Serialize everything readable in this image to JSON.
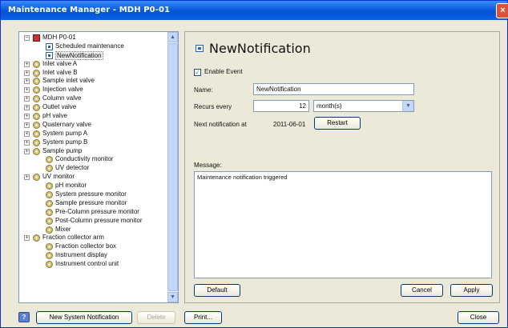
{
  "window": {
    "title": "Maintenance Manager - MDH P0-01",
    "close_glyph": "×"
  },
  "tree": {
    "items": [
      {
        "label": "MDH P0-01",
        "icon": "root-icon",
        "level": 0,
        "expander": "−"
      },
      {
        "label": "Scheduled maintenance",
        "icon": "notification-icon",
        "level": 1,
        "expander": ""
      },
      {
        "label": "NewNotification",
        "icon": "notification-icon",
        "level": 1,
        "expander": "",
        "selected": true
      },
      {
        "label": "Inlet valve A",
        "icon": "gear-icon",
        "level": 0,
        "expander": "+"
      },
      {
        "label": "Inlet valve B",
        "icon": "gear-icon",
        "level": 0,
        "expander": "+"
      },
      {
        "label": "Sample inlet valve",
        "icon": "gear-icon",
        "level": 0,
        "expander": "+"
      },
      {
        "label": "Injection valve",
        "icon": "gear-icon",
        "level": 0,
        "expander": "+"
      },
      {
        "label": "Column valve",
        "icon": "gear-icon",
        "level": 0,
        "expander": "+"
      },
      {
        "label": "Outlet valve",
        "icon": "gear-icon",
        "level": 0,
        "expander": "+"
      },
      {
        "label": "pH valve",
        "icon": "gear-icon",
        "level": 0,
        "expander": "+"
      },
      {
        "label": "Quaternary valve",
        "icon": "gear-icon",
        "level": 0,
        "expander": "+"
      },
      {
        "label": "System pump A",
        "icon": "gear-icon",
        "level": 0,
        "expander": "+"
      },
      {
        "label": "System pump B",
        "icon": "gear-icon",
        "level": 0,
        "expander": "+"
      },
      {
        "label": "Sample pump",
        "icon": "gear-icon",
        "level": 0,
        "expander": "+"
      },
      {
        "label": "Conductivity monitor",
        "icon": "gear-icon",
        "level": 1,
        "expander": ""
      },
      {
        "label": "UV detector",
        "icon": "gear-icon",
        "level": 1,
        "expander": ""
      },
      {
        "label": "UV monitor",
        "icon": "gear-icon",
        "level": 0,
        "expander": "+"
      },
      {
        "label": "pH monitor",
        "icon": "gear-icon",
        "level": 1,
        "expander": ""
      },
      {
        "label": "System pressure monitor",
        "icon": "gear-icon",
        "level": 1,
        "expander": ""
      },
      {
        "label": "Sample pressure monitor",
        "icon": "gear-icon",
        "level": 1,
        "expander": ""
      },
      {
        "label": "Pre-Column pressure monitor",
        "icon": "gear-icon",
        "level": 1,
        "expander": ""
      },
      {
        "label": "Post-Column pressure monitor",
        "icon": "gear-icon",
        "level": 1,
        "expander": ""
      },
      {
        "label": "Mixer",
        "icon": "gear-icon",
        "level": 1,
        "expander": ""
      },
      {
        "label": "Fraction collector arm",
        "icon": "gear-icon",
        "level": 0,
        "expander": "+"
      },
      {
        "label": "Fraction collector box",
        "icon": "gear-icon",
        "level": 1,
        "expander": ""
      },
      {
        "label": "Instrument display",
        "icon": "gear-icon",
        "level": 1,
        "expander": ""
      },
      {
        "label": "Instrument control unit",
        "icon": "gear-icon",
        "level": 1,
        "expander": ""
      }
    ]
  },
  "detail": {
    "title": "NewNotification",
    "enable_label": "Enable Event",
    "enable_checked": true,
    "check_glyph": "✓",
    "name_label": "Name:",
    "name_value": "NewNotification",
    "recurs_label": "Recurs every",
    "recurs_value": "12",
    "recurs_unit": "month(s)",
    "next_label": "Next notification at",
    "next_value": "2011-06-01",
    "restart_label": "Restart",
    "message_label": "Message:",
    "message_value": "Maintenance notification triggered",
    "default_label": "Default",
    "cancel_label": "Cancel",
    "apply_label": "Apply"
  },
  "footer": {
    "help_glyph": "?",
    "new_label": "New System Notification",
    "delete_label": "Delete",
    "print_label": "Print...",
    "close_label": "Close"
  }
}
